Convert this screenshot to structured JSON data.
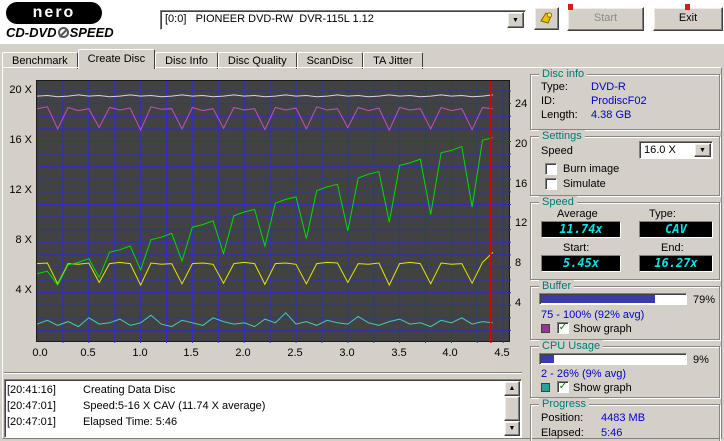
{
  "header": {
    "brand": "nero",
    "product_cd": "CD-DVD",
    "product_speed": "SPEED",
    "drive_select": {
      "value": "[0:0]   PIONEER DVD-RW  DVR-115L 1.12"
    },
    "start_button": "Start",
    "exit_button": "Exit"
  },
  "tabs": [
    {
      "label": "Benchmark"
    },
    {
      "label": "Create Disc"
    },
    {
      "label": "Disc Info"
    },
    {
      "label": "Disc Quality"
    },
    {
      "label": "ScanDisc"
    },
    {
      "label": "TA Jitter"
    }
  ],
  "chart_data": {
    "type": "line",
    "plot_bg": "#424242",
    "grid_color": "#2e2ec6",
    "marker_color": "#dd0000",
    "marker_x": 4.38,
    "xlim": [
      0,
      4.575
    ],
    "ylim": [
      0,
      20.8
    ],
    "x_grid_step": 0.25,
    "y_grid_step": 1,
    "x_ticks": [
      "0.0",
      "0.5",
      "1.0",
      "1.5",
      "2.0",
      "2.5",
      "3.0",
      "3.5",
      "4.0",
      "4.5"
    ],
    "y_left": [
      "20 X",
      "16 X",
      "12 X",
      "8 X",
      "4 X"
    ],
    "y_right": [
      "24",
      "20",
      "16",
      "12",
      "8",
      "4"
    ],
    "series": [
      {
        "name": "spindle-rpm",
        "color": "#d8d2e2",
        "x_step": 0.1,
        "values": [
          19.6,
          19.65,
          19.55,
          19.6,
          19.7,
          19.6,
          19.65,
          19.55,
          19.6,
          19.7,
          19.6,
          19.65,
          19.55,
          19.6,
          19.7,
          19.6,
          19.65,
          19.55,
          19.6,
          19.7,
          19.6,
          19.65,
          19.55,
          19.6,
          19.7,
          19.6,
          19.65,
          19.55,
          19.6,
          19.7,
          19.6,
          19.65,
          19.55,
          19.6,
          19.7,
          19.6,
          19.65,
          19.55,
          19.6,
          19.7,
          19.6,
          19.65,
          19.55,
          19.6,
          19.7
        ]
      },
      {
        "name": "buffer-graph",
        "color": "#c050c0",
        "x_step": 0.1,
        "values": [
          18.6,
          18.75,
          17.0,
          18.7,
          18.45,
          18.6,
          17.1,
          18.7,
          18.5,
          18.65,
          16.9,
          18.75,
          18.55,
          18.6,
          17.0,
          18.7,
          18.45,
          18.6,
          17.05,
          18.7,
          18.5,
          18.6,
          16.95,
          18.7,
          18.5,
          18.65,
          17.0,
          18.75,
          18.5,
          18.6,
          17.1,
          18.7,
          18.45,
          18.65,
          16.9,
          18.7,
          18.5,
          18.6,
          17.0,
          18.7,
          18.45,
          18.6,
          16.95,
          18.7,
          18.6
        ]
      },
      {
        "name": "device-buffer",
        "color": "#e6e600",
        "x_step": 0.1,
        "values": [
          6.3,
          6.35,
          4.7,
          6.3,
          6.25,
          6.35,
          4.8,
          6.3,
          6.4,
          6.3,
          4.6,
          6.35,
          6.25,
          6.3,
          4.7,
          6.3,
          6.35,
          6.25,
          4.75,
          6.3,
          6.4,
          6.3,
          4.65,
          6.3,
          6.35,
          6.25,
          4.7,
          6.3,
          6.4,
          6.35,
          4.8,
          6.3,
          6.25,
          6.35,
          4.6,
          6.3,
          6.4,
          6.3,
          4.7,
          6.35,
          6.25,
          6.3,
          4.75,
          6.4,
          7.2
        ]
      },
      {
        "name": "cpu-graph",
        "color": "#45c8c8",
        "x_step": 0.1,
        "values": [
          1.5,
          1.8,
          1.4,
          1.7,
          1.3,
          2.0,
          1.5,
          1.6,
          1.9,
          1.4,
          1.6,
          2.2,
          1.5,
          1.3,
          1.8,
          1.6,
          1.4,
          2.0,
          1.7,
          1.5,
          1.6,
          1.3,
          1.9,
          1.6,
          2.4,
          1.5,
          1.7,
          1.4,
          1.8,
          1.6,
          1.5,
          2.1,
          1.6,
          1.4,
          1.7,
          1.9,
          1.5,
          1.6,
          1.3,
          1.8,
          1.6,
          2.0,
          1.5,
          1.7,
          1.6
        ]
      },
      {
        "name": "write-speed",
        "color": "#00dd00",
        "x_step": 0.1,
        "values": [
          5.5,
          5.7,
          4.6,
          6.2,
          6.4,
          6.7,
          5.2,
          7.2,
          7.4,
          7.7,
          5.8,
          8.2,
          8.4,
          8.7,
          6.5,
          9.2,
          9.4,
          9.7,
          7.1,
          10.1,
          10.4,
          10.6,
          7.7,
          11.1,
          11.4,
          11.6,
          8.3,
          12.1,
          12.4,
          12.6,
          8.9,
          13.1,
          13.4,
          13.6,
          9.6,
          14.1,
          14.3,
          14.6,
          10.2,
          15.1,
          15.3,
          15.6,
          10.8,
          16.1,
          16.3
        ]
      }
    ]
  },
  "panels": {
    "disc_info": {
      "title": "Disc info",
      "rows": [
        {
          "label": "Type:",
          "value": "DVD-R"
        },
        {
          "label": "ID:",
          "value": "ProdiscF02"
        },
        {
          "label": "Length:",
          "value": "4.38 GB"
        }
      ]
    },
    "settings": {
      "title": "Settings",
      "speed_label": "Speed",
      "speed_value": "16.0 X",
      "burn_image": {
        "label": "Burn image",
        "checked": false
      },
      "simulate": {
        "label": "Simulate",
        "checked": false
      }
    },
    "speed": {
      "title": "Speed",
      "average_label": "Average",
      "average": "11.74x",
      "type_label": "Type:",
      "type": "CAV",
      "start_label": "Start:",
      "start": "5.45x",
      "end_label": "End:",
      "end": "16.27x"
    },
    "buffer": {
      "title": "Buffer",
      "percent": 79,
      "percent_label": "79%",
      "range": "75 - 100% (92% avg)",
      "swatch_color": "#993399",
      "show_graph": "Show graph",
      "checked": true
    },
    "cpu": {
      "title": "CPU Usage",
      "percent": 9,
      "percent_label": "9%",
      "range": "2 - 26% (9% avg)",
      "swatch_color": "#2f9e9e",
      "show_graph": "Show graph",
      "checked": true
    },
    "progress": {
      "title": "Progress",
      "position_label": "Position:",
      "position": "4483 MB",
      "elapsed_label": "Elapsed:",
      "elapsed": "5:46"
    }
  },
  "log": {
    "lines": [
      {
        "time": "[20:41:16]",
        "text": "Creating Data Disc"
      },
      {
        "time": "[20:47:01]",
        "text": "Speed:5-16 X CAV (11.74 X average)"
      },
      {
        "time": "[20:47:01]",
        "text": "Elapsed Time: 5:46"
      }
    ]
  }
}
